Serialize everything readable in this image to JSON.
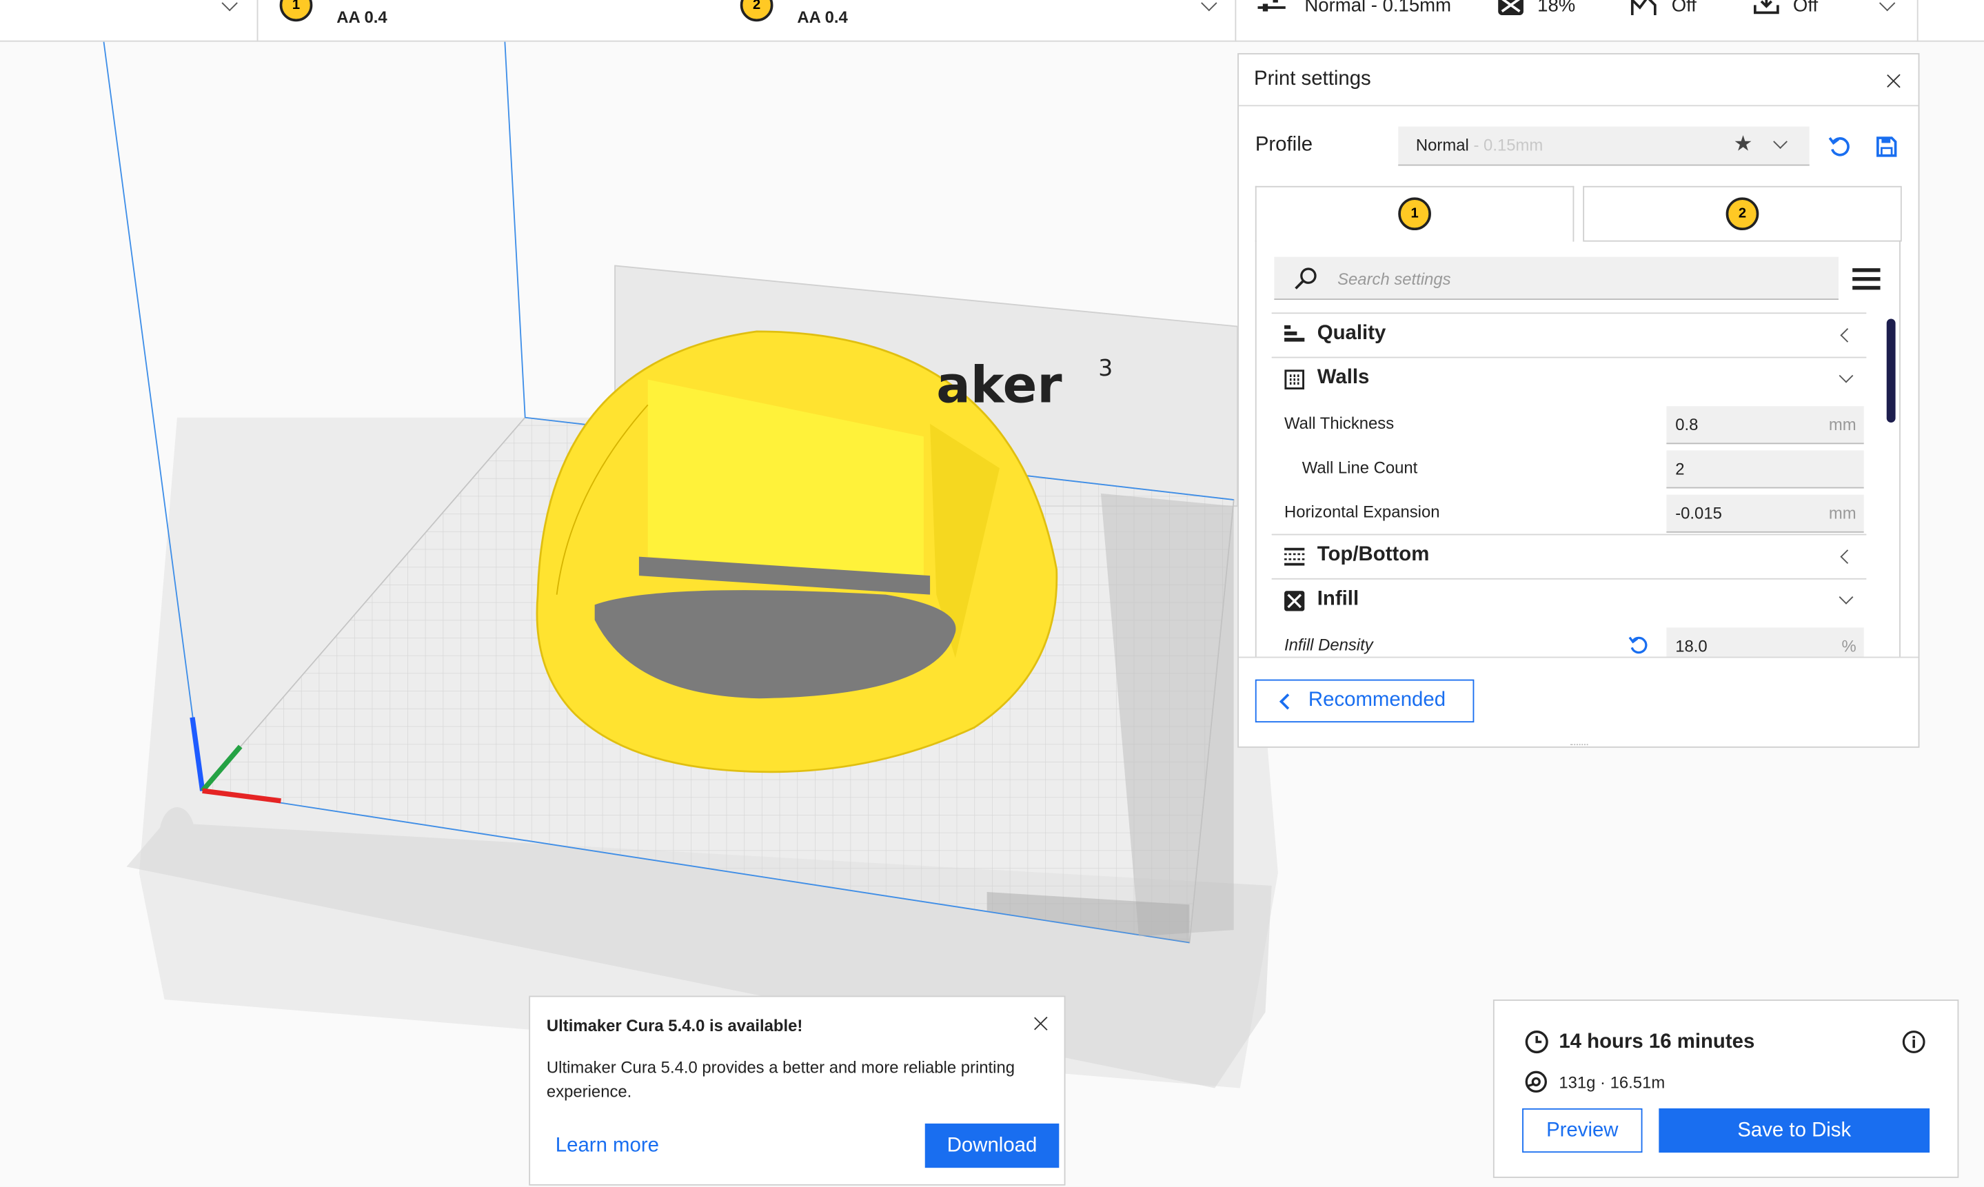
{
  "topbar": {
    "extruder1": {
      "number": "1",
      "nozzle": "AA 0.4"
    },
    "extruder2": {
      "number": "2",
      "nozzle": "AA 0.4"
    },
    "profile_summary": "Normal - 0.15mm",
    "infill_summary": "18%",
    "support_summary": "Off",
    "adhesion_summary": "Off"
  },
  "viewport": {
    "backplate_text": "aker",
    "backplate_superscript": "3"
  },
  "print_settings": {
    "title": "Print settings",
    "profile_label": "Profile",
    "profile_name": "Normal",
    "profile_sub": " - 0.15mm",
    "tabs": [
      {
        "number": "1"
      },
      {
        "number": "2"
      }
    ],
    "search_placeholder": "Search settings",
    "categories": {
      "quality": "Quality",
      "walls": "Walls",
      "top_bottom": "Top/Bottom",
      "infill": "Infill"
    },
    "settings": [
      {
        "label": "Wall Thickness",
        "value": "0.8",
        "unit": "mm"
      },
      {
        "label": "Wall Line Count",
        "value": "2",
        "unit": ""
      },
      {
        "label": "Horizontal Expansion",
        "value": "-0.015",
        "unit": "mm"
      },
      {
        "label": "Infill Density",
        "value": "18.0",
        "unit": "%"
      }
    ],
    "recommended_label": "Recommended"
  },
  "notification": {
    "title": "Ultimaker Cura 5.4.0 is available!",
    "body": "Ultimaker Cura 5.4.0 provides a better and more reliable printing experience.",
    "learn_more": "Learn more",
    "download": "Download"
  },
  "estimate": {
    "time": "14 hours 16 minutes",
    "material": "131g · 16.51m",
    "preview": "Preview",
    "save": "Save to Disk"
  },
  "colors": {
    "accent": "#196ef0",
    "model": "#ffe330",
    "extruder_badge": "#ffc924"
  }
}
